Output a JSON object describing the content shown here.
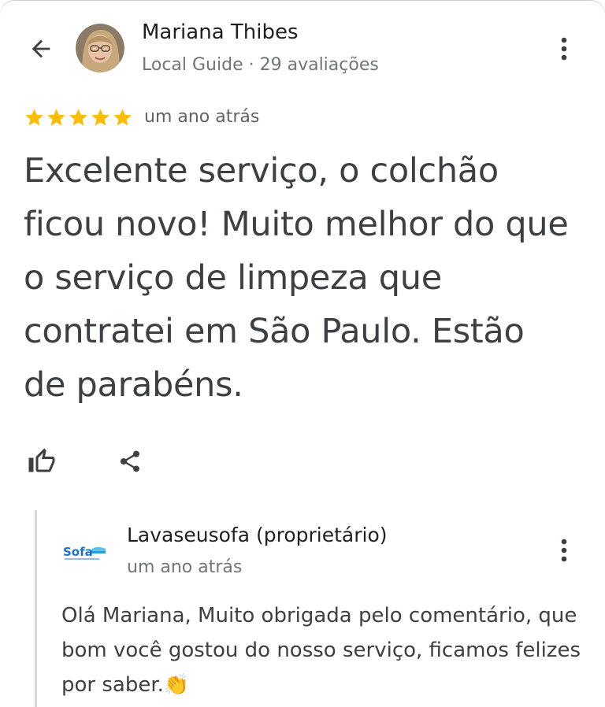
{
  "header": {
    "author_name": "Mariana Thibes",
    "author_meta": "Local Guide · 29 avaliações"
  },
  "review": {
    "rating": 5,
    "rating_max": 5,
    "star_color": "#fbbc04",
    "time": "um ano atrás",
    "text": "Excelente serviço, o colchão ficou novo! Muito melhor do que o serviço de limpeza que contratei em São Paulo. Estão de parabéns."
  },
  "actions": {
    "like_icon": "thumb-up-icon",
    "share_icon": "share-icon"
  },
  "owner_reply": {
    "owner_name": "Lavaseusofa (proprietário)",
    "time": "um ano atrás",
    "text": "Olá Mariana, Muito obrigada pelo comentário, que bom você gostou do nosso serviço, ficamos felizes por saber.👏",
    "logo_text": "Sofa",
    "logo_color": "#1a73c8"
  }
}
